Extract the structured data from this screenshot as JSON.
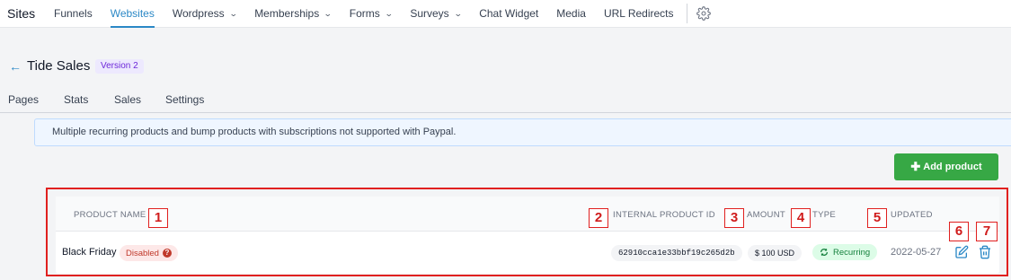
{
  "nav": {
    "brand": "Sites",
    "items": [
      {
        "label": "Funnels",
        "dropdown": false,
        "active": false
      },
      {
        "label": "Websites",
        "dropdown": false,
        "active": true
      },
      {
        "label": "Wordpress",
        "dropdown": true,
        "active": false
      },
      {
        "label": "Memberships",
        "dropdown": true,
        "active": false
      },
      {
        "label": "Forms",
        "dropdown": true,
        "active": false
      },
      {
        "label": "Surveys",
        "dropdown": true,
        "active": false
      },
      {
        "label": "Chat Widget",
        "dropdown": false,
        "active": false
      },
      {
        "label": "Media",
        "dropdown": false,
        "active": false
      },
      {
        "label": "URL Redirects",
        "dropdown": false,
        "active": false
      }
    ],
    "settings_icon": "gear-icon"
  },
  "page": {
    "back_icon": "arrow-left-icon",
    "title": "Tide Sales",
    "version": "Version 2"
  },
  "tabs": [
    "Pages",
    "Stats",
    "Sales",
    "Settings"
  ],
  "notice": "Multiple recurring products and bump products with subscriptions not supported with Paypal.",
  "add_product": {
    "icon": "plus-icon",
    "label": "Add product"
  },
  "table": {
    "columns": {
      "name": "PRODUCT NAME",
      "id": "INTERNAL PRODUCT ID",
      "amount": "AMOUNT",
      "type": "TYPE",
      "updated": "UPDATED"
    },
    "rows": [
      {
        "name": "Black Friday",
        "status": "Disabled",
        "status_icon": "question-circle-icon",
        "internal_id": "62910cca1e33bbf19c265d2b",
        "amount": "$ 100 USD",
        "type": "Recurring",
        "type_icon": "refresh-icon",
        "updated": "2022-05-27",
        "actions": [
          "edit-icon",
          "trash-icon"
        ]
      }
    ]
  },
  "annotations": [
    "1",
    "2",
    "3",
    "4",
    "5",
    "6",
    "7"
  ],
  "colors": {
    "accent": "#2b88c6",
    "success": "#37a845",
    "danger": "#c0392b",
    "annotation": "#e0201f",
    "version_badge": "#6d28d9"
  }
}
